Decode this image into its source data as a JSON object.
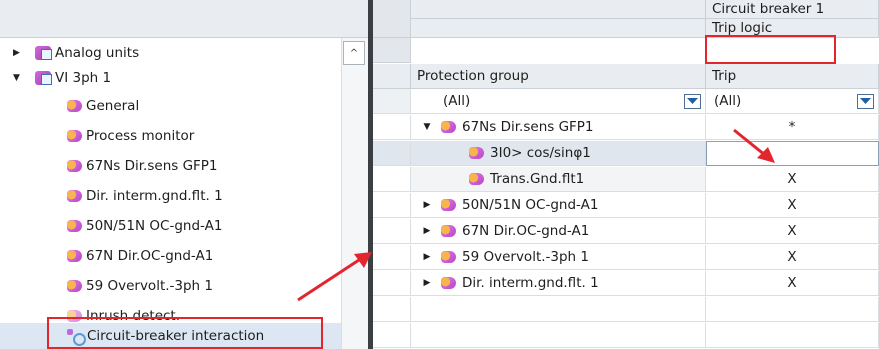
{
  "tree": {
    "items": [
      {
        "label": "Analog units",
        "expander": "▶",
        "icon": "analog-units-module-icon",
        "indent": 1
      },
      {
        "label": "VI 3ph 1",
        "expander": "▼",
        "icon": "vi-module-icon",
        "indent": 1
      },
      {
        "label": "General",
        "icon": "function-icon",
        "indent": 2
      },
      {
        "label": "Process monitor",
        "icon": "function-icon",
        "indent": 2
      },
      {
        "label": "67Ns Dir.sens GFP1",
        "icon": "function-icon",
        "indent": 2
      },
      {
        "label": "Dir. interm.gnd.flt. 1",
        "icon": "function-icon",
        "indent": 2
      },
      {
        "label": "50N/51N OC-gnd-A1",
        "icon": "function-icon",
        "indent": 2
      },
      {
        "label": "67N Dir.OC-gnd-A1",
        "icon": "function-icon",
        "indent": 2
      },
      {
        "label": "59 Overvolt.-3ph 1",
        "icon": "function-icon",
        "indent": 2
      },
      {
        "label": "Inrush detect.",
        "icon": "function-icon",
        "indent": 2,
        "dim": true
      },
      {
        "label": "Circuit-breaker interaction",
        "icon": "circuit-breaker-icon",
        "indent": 2,
        "selected": true
      }
    ],
    "scroll_up_glyph": "^"
  },
  "grid": {
    "header_circuit_breaker": "Circuit breaker 1",
    "header_trip_logic": "Trip logic",
    "col_protection_group": "Protection group",
    "col_trip": "Trip",
    "filter_group": "(All)",
    "filter_trip": "(All)",
    "rows": [
      {
        "expander": "▼",
        "label": "67Ns Dir.sens GFP1",
        "trip": "*",
        "level": 1
      },
      {
        "expander": "",
        "label": "3I0> cos/sinφ1",
        "trip": "",
        "level": 2,
        "editing": true
      },
      {
        "expander": "",
        "label": "Trans.Gnd.flt1",
        "trip": "X",
        "level": 2
      },
      {
        "expander": "▶",
        "label": "50N/51N OC-gnd-A1",
        "trip": "X",
        "level": 1
      },
      {
        "expander": "▶",
        "label": "67N Dir.OC-gnd-A1",
        "trip": "X",
        "level": 1
      },
      {
        "expander": "▶",
        "label": "59 Overvolt.-3ph 1",
        "trip": "X",
        "level": 1
      },
      {
        "expander": "▶",
        "label": "Dir. interm.gnd.flt. 1",
        "trip": "X",
        "level": 1
      }
    ]
  },
  "colors": {
    "highlight_red": "#e3262e",
    "dropdown_blue": "#1f5fa8",
    "divider": "#3b3f44"
  }
}
